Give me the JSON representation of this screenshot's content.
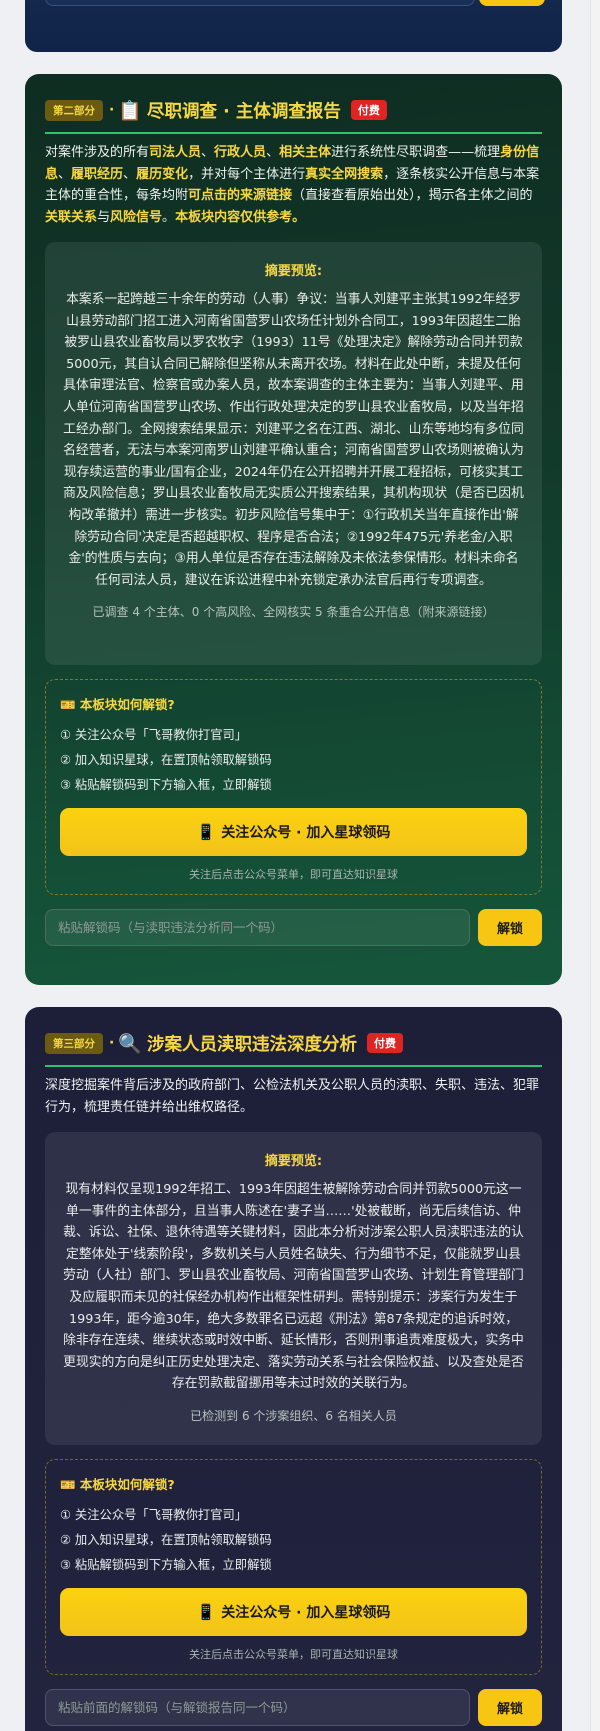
{
  "card2": {
    "part_badge": "第二部分",
    "dot": "·",
    "icon": "📋",
    "title": "尽职调查 · 主体调查报告",
    "paid_badge": "付费",
    "intro": [
      {
        "t": "对案件涉及的所有"
      },
      {
        "b": "司法人员"
      },
      {
        "t": "、"
      },
      {
        "b": "行政人员"
      },
      {
        "t": "、"
      },
      {
        "b": "相关主体"
      },
      {
        "t": "进行系统性尽职调查——梳理"
      },
      {
        "b": "身份信息"
      },
      {
        "t": "、"
      },
      {
        "b": "履职经历"
      },
      {
        "t": "、"
      },
      {
        "b": "履历变化"
      },
      {
        "t": "，并对每个主体进行"
      },
      {
        "b": "真实全网搜索"
      },
      {
        "t": "，逐条核实公开信息与本案主体的重合性，每条均附"
      },
      {
        "b": "可点击的来源链接"
      },
      {
        "t": "（直接查看原始出处），揭示各主体之间的"
      },
      {
        "b": "关联关系"
      },
      {
        "t": "与"
      },
      {
        "b": "风险信号"
      },
      {
        "t": "。"
      },
      {
        "b": "本板块内容仅供参考。"
      }
    ],
    "summary_label": "摘要预览:",
    "summary_text": "本案系一起跨越三十余年的劳动（人事）争议：当事人刘建平主张其1992年经罗山县劳动部门招工进入河南省国营罗山农场任计划外合同工，1993年因超生二胎被罗山县农业畜牧局以罗农牧字（1993）11号《处理决定》解除劳动合同并罚款5000元，其自认合同已解除但坚称从未离开农场。材料在此处中断，未提及任何具体审理法官、检察官或办案人员，故本案调查的主体主要为：当事人刘建平、用人单位河南省国营罗山农场、作出行政处理决定的罗山县农业畜牧局，以及当年招工经办部门。全网搜索结果显示：刘建平之名在江西、湖北、山东等地均有多位同名经营者，无法与本案河南罗山刘建平确认重合；河南省国营罗山农场则被确认为现存续运营的事业/国有企业，2024年仍在公开招聘并开展工程招标，可核实其工商及风险信息；罗山县农业畜牧局无实质公开搜索结果，其机构现状（是否已因机构改革撤并）需进一步核实。初步风险信号集中于：①行政机关当年直接作出'解除劳动合同'决定是否超越职权、程序是否合法；②1992年475元'养老金/入职金'的性质与去向；③用人单位是否存在违法解除及未依法参保情形。材料未命名任何司法人员，建议在诉讼进程中补充锁定承办法官后再行专项调查。",
    "summary_stat": "已调查 4 个主体、0 个高风险、全网核实 5 条重合公开信息（附来源链接）",
    "unlock_title": "🎫 本板块如何解锁?",
    "steps": [
      "① 关注公众号「飞哥教你打官司」",
      "② 加入知识星球，在置顶帖领取解锁码",
      "③ 粘贴解锁码到下方输入框，立即解锁"
    ],
    "follow_icon": "📱",
    "follow_label": "关注公众号 · 加入星球领码",
    "follow_hint": "关注后点击公众号菜单，即可直达知识星球",
    "code_placeholder": "粘贴解锁码（与渎职违法分析同一个码）",
    "code_button": "解锁"
  },
  "card3": {
    "part_badge": "第三部分",
    "dot": "·",
    "icon": "🔍",
    "title": "涉案人员渎职违法深度分析",
    "paid_badge": "付费",
    "intro": [
      {
        "t": "深度挖掘案件背后涉及的政府部门、公检法机关及公职人员的渎职、失职、违法、犯罪行为，梳理责任链并给出维权路径。"
      }
    ],
    "summary_label": "摘要预览:",
    "summary_text": "现有材料仅呈现1992年招工、1993年因超生被解除劳动合同并罚款5000元这一单一事件的主体部分，且当事人陈述在'妻子当……'处被截断，尚无后续信访、仲裁、诉讼、社保、退休待遇等关键材料，因此本分析对涉案公职人员渎职违法的认定整体处于'线索阶段'，多数机关与人员姓名缺失、行为细节不足，仅能就罗山县劳动（人社）部门、罗山县农业畜牧局、河南省国营罗山农场、计划生育管理部门及应履职而未见的社保经办机构作出框架性研判。需特别提示：涉案行为发生于1993年，距今逾30年，绝大多数罪名已远超《刑法》第87条规定的追诉时效，除非存在连续、继续状态或时效中断、延长情形，否则刑事追责难度极大，实务中更现实的方向是纠正历史处理决定、落实劳动关系与社会保险权益、以及查处是否存在罚款截留挪用等未过时效的关联行为。",
    "summary_stat": "已检测到 6 个涉案组织、6 名相关人员",
    "unlock_title": "🎫 本板块如何解锁?",
    "steps": [
      "① 关注公众号「飞哥教你打官司」",
      "② 加入知识星球，在置顶帖领取解锁码",
      "③ 粘贴解锁码到下方输入框，立即解锁"
    ],
    "follow_icon": "📱",
    "follow_label": "关注公众号 · 加入星球领码",
    "follow_hint": "关注后点击公众号菜单，即可直达知识星球",
    "code_placeholder": "粘贴前面的解锁码（与解锁报告同一个码）",
    "code_button": "解锁"
  }
}
